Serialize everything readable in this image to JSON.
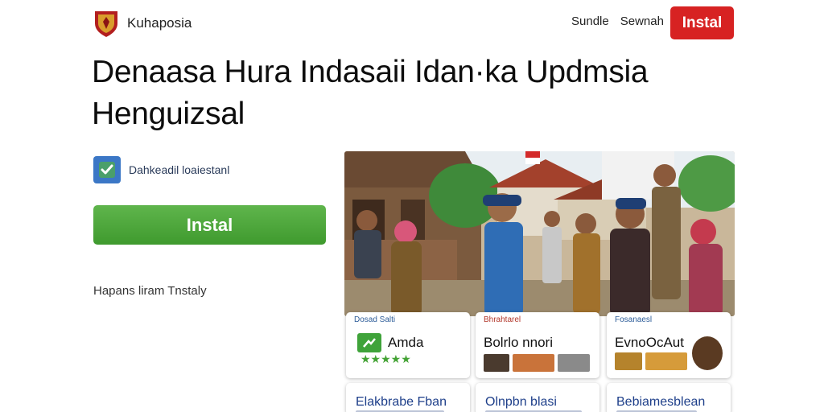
{
  "header": {
    "brand": "Kuhaposia",
    "nav": [
      "Sundle",
      "Sewnah"
    ],
    "cta_label": "Instal"
  },
  "headline": {
    "line1": "Denaasa Hura Indasaii Idan·ka Updmsia",
    "line2": "Henguizsal"
  },
  "left": {
    "feature_text": "Dahkeadil loaiestanl",
    "install_label": "Instal",
    "sub_text": "Hapans liram Tnstaly"
  },
  "cards": [
    {
      "label": "Dosad Salti",
      "title": "Amda",
      "stars": "★★★★★"
    },
    {
      "label": "Bhrahtarel",
      "title": "Bolrlo nnori"
    },
    {
      "label": "Fosanaesl",
      "title": "EvnoOcAut"
    }
  ],
  "bottom_cards": [
    "Elakbrabe Fban",
    "Olnpbn blasi",
    "Bebiamesblean"
  ],
  "colors": {
    "header_cta": "#d72222",
    "install_button": "#4aa738",
    "feature_icon": "#3b77c6",
    "star": "#43a234"
  }
}
